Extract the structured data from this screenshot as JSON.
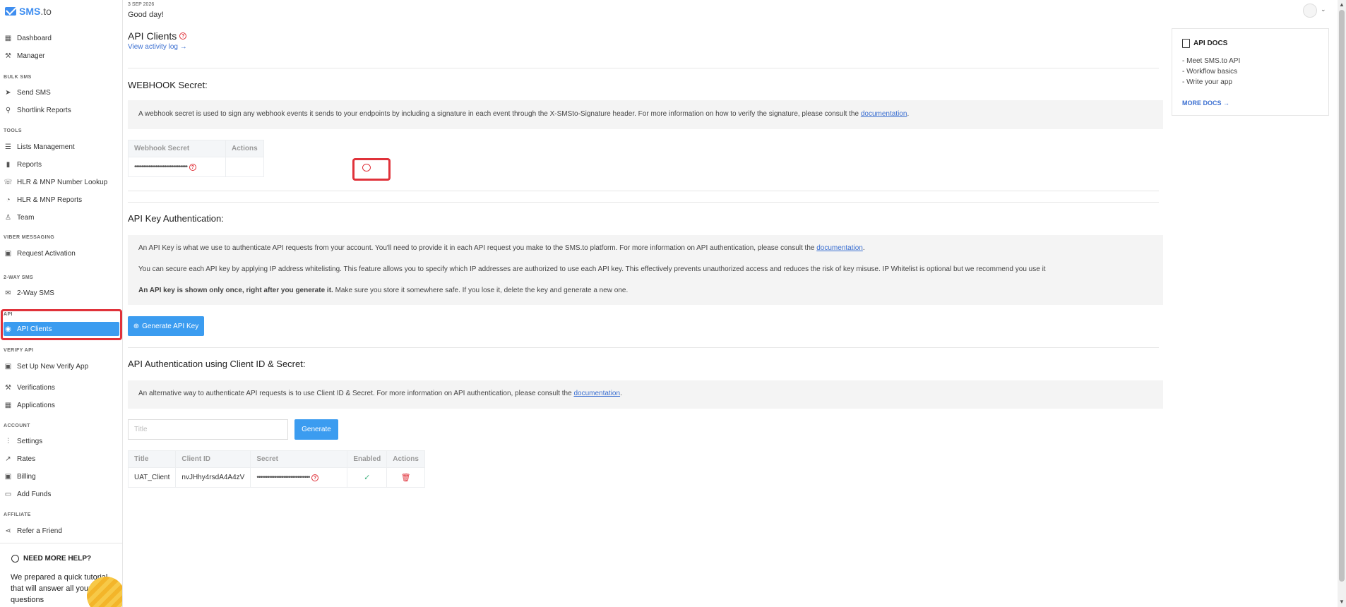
{
  "brand": {
    "name": "SMS",
    "suffix": ".to"
  },
  "header": {
    "date": "3 SEP 2026",
    "greeting": "Good day!"
  },
  "sidebar": {
    "top": [
      {
        "label": "Dashboard",
        "icon": "grid-icon"
      },
      {
        "label": "Manager",
        "icon": "wrench-icon"
      }
    ],
    "sections": [
      {
        "title": "BULK SMS",
        "items": [
          {
            "label": "Send SMS",
            "icon": "send-icon"
          },
          {
            "label": "Shortlink Reports",
            "icon": "link-icon"
          }
        ]
      },
      {
        "title": "TOOLS",
        "items": [
          {
            "label": "Lists Management",
            "icon": "list-icon"
          },
          {
            "label": "Reports",
            "icon": "bar-chart-icon"
          },
          {
            "label": "HLR & MNP Number Lookup",
            "icon": "phone-icon"
          },
          {
            "label": "HLR & MNP Reports",
            "icon": "pie-icon"
          },
          {
            "label": "Team",
            "icon": "user-icon"
          }
        ]
      },
      {
        "title": "VIBER MESSAGING",
        "items": [
          {
            "label": "Request Activation",
            "icon": "calendar-icon"
          }
        ]
      },
      {
        "title": "2-WAY SMS",
        "items": [
          {
            "label": "2-Way SMS",
            "icon": "mail-icon"
          }
        ]
      },
      {
        "title": "API",
        "items": [
          {
            "label": "API Clients",
            "icon": "rss-icon"
          }
        ]
      },
      {
        "title": "VERIFY API",
        "items": [
          {
            "label": "Set Up New Verify App",
            "icon": "calendar-icon"
          },
          {
            "label": "Verifications",
            "icon": "wrench-icon"
          },
          {
            "label": "Applications",
            "icon": "grid-icon"
          }
        ]
      },
      {
        "title": "ACCOUNT",
        "items": [
          {
            "label": "Settings",
            "icon": "sliders-icon"
          },
          {
            "label": "Rates",
            "icon": "trend-icon"
          },
          {
            "label": "Billing",
            "icon": "calendar-icon"
          },
          {
            "label": "Add Funds",
            "icon": "card-icon"
          }
        ]
      },
      {
        "title": "AFFILIATE",
        "items": [
          {
            "label": "Refer a Friend",
            "icon": "share-icon"
          }
        ]
      }
    ],
    "help": {
      "title": "NEED MORE HELP?",
      "text": "We prepared a quick tutorial that will answer all your questions"
    }
  },
  "page": {
    "title": "API Clients",
    "activity_link": "View activity log →",
    "webhook": {
      "heading": "WEBHOOK Secret:",
      "info_pre": "A webhook secret is used to sign any webhook events it sends to your endpoints by including a signature in each event through the X-SMSto-Signature header. For more information on how to verify the signature, please consult the ",
      "info_link": "documentation",
      "info_post": ".",
      "col_secret": "Webhook Secret",
      "col_actions": "Actions",
      "secret_value": "••••••••••••••••••••••••••••••"
    },
    "apikey": {
      "heading": "API Key Authentication:",
      "p1_pre": "An API Key is what we use to authenticate API requests from your account. You'll need to provide it in each API request you make to the SMS.to platform. For more information on API authentication, please consult the ",
      "p1_link": "documentation",
      "p1_post": ".",
      "p2": "You can secure each API key by applying IP address whitelisting. This feature allows you to specify which IP addresses are authorized to use each API key. This effectively prevents unauthorized access and reduces the risk of key misuse. IP Whitelist is optional but we recommend you use it",
      "p3_bold": "An API key is shown only once, right after you generate it.",
      "p3_rest": " Make sure you store it somewhere safe. If you lose it, delete the key and generate a new one.",
      "button": "Generate API Key"
    },
    "client": {
      "heading": "API Authentication using Client ID & Secret:",
      "info_pre": "An alternative way to authenticate API requests is to use Client ID & Secret. For more information on API authentication, please consult the ",
      "info_link": "documentation",
      "info_post": ".",
      "title_placeholder": "Title",
      "generate": "Generate",
      "columns": [
        "Title",
        "Client ID",
        "Secret",
        "Enabled",
        "Actions"
      ],
      "rows": [
        {
          "title": "UAT_Client",
          "client_id": "nvJHhy4rsdA4A4zV",
          "secret": "••••••••••••••••••••••••••••••"
        }
      ]
    }
  },
  "docs": {
    "title": "API DOCS",
    "links": [
      "- Meet SMS.to API",
      "- Workflow basics",
      "- Write your app"
    ],
    "more": "MORE DOCS →"
  },
  "colors": {
    "accent": "#3b9cf0",
    "danger": "#e0323a",
    "link": "#3b6fd1"
  }
}
